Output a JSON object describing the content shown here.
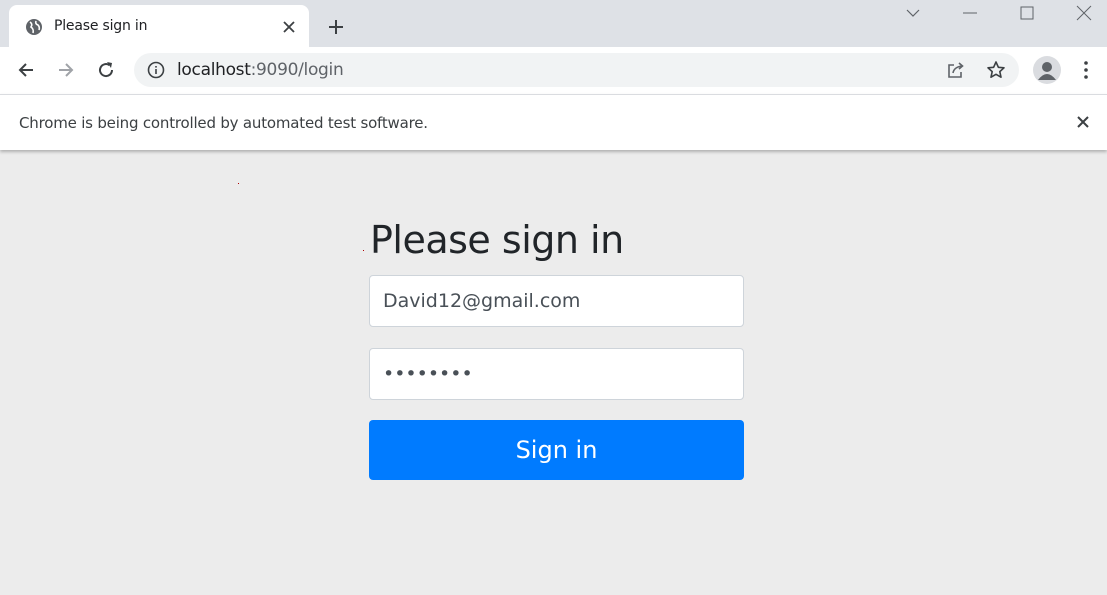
{
  "browser": {
    "tab_title": "Please sign in",
    "url_host": "localhost",
    "url_rest": ":9090/login",
    "infobar_text": "Chrome is being controlled by automated test software."
  },
  "page": {
    "heading": "Please sign in",
    "username_value": "David12@gmail.com",
    "password_value": "eightchr",
    "signin_label": "Sign in"
  },
  "colors": {
    "primary": "#007bff",
    "page_background": "#ececec",
    "tabstrip": "#dee1e6"
  },
  "icons": [
    "globe-icon",
    "close-icon",
    "plus-icon",
    "chevron-down-icon",
    "minimize-icon",
    "maximize-icon",
    "window-close-icon",
    "back-arrow-icon",
    "forward-arrow-icon",
    "reload-icon",
    "info-icon",
    "share-icon",
    "star-icon",
    "profile-icon",
    "kebab-menu-icon"
  ]
}
